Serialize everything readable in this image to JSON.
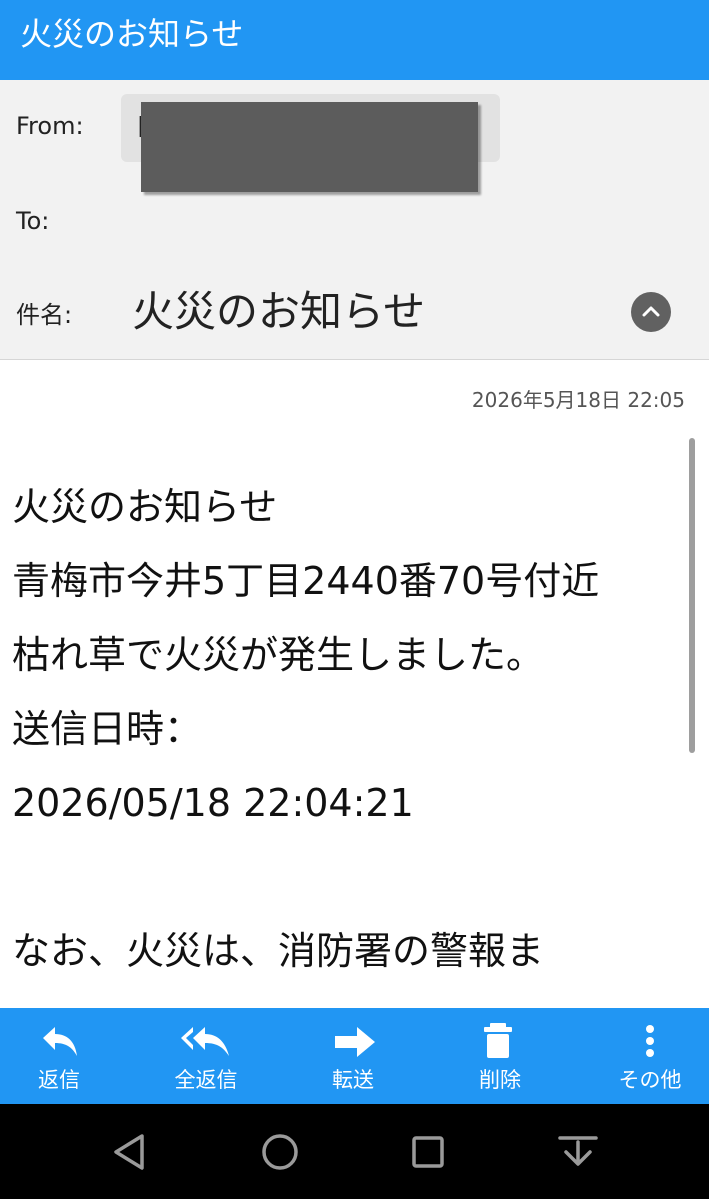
{
  "title_bar": {
    "title": "火災のお知らせ"
  },
  "header": {
    "from_label": "From:",
    "from_value_visible": "l                                        o",
    "to_label": "To:",
    "subject_label": "件名:",
    "subject_value": "火災のお知らせ"
  },
  "message": {
    "date": "2026年5月18日 22:05",
    "lines": [
      "火災のお知らせ",
      "青梅市今井5丁目2440番70号付近",
      "枯れ草で火災が発生しました。",
      "送信日時：",
      "2026/05/18 22:04:21",
      "",
      "なお、火災は、消防署の警報ま"
    ]
  },
  "actions": [
    {
      "label": "返信",
      "icon": "reply-icon"
    },
    {
      "label": "全返信",
      "icon": "reply-all-icon"
    },
    {
      "label": "転送",
      "icon": "forward-icon"
    },
    {
      "label": "削除",
      "icon": "trash-icon"
    },
    {
      "label": "その他",
      "icon": "more-vertical-icon"
    }
  ],
  "navbar": {
    "icons": [
      "back-triangle-icon",
      "home-circle-icon",
      "recents-square-icon",
      "notification-dismiss-icon"
    ]
  },
  "colors": {
    "accent": "#2196f3",
    "header_bg": "#f2f2f2",
    "nav_bg": "#000000"
  }
}
